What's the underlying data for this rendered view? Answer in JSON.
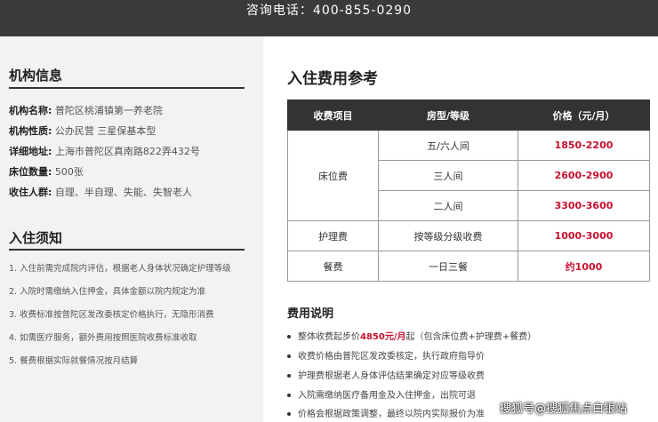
{
  "header": {
    "consult": "咨询电话：400-855-0290"
  },
  "sidebar": {
    "info_title": "机构信息",
    "info": [
      {
        "k": "机构名称:",
        "v": "普陀区桃浦镇第一养老院"
      },
      {
        "k": "机构性质:",
        "v": "公办民营 三星保基本型"
      },
      {
        "k": "详细地址:",
        "v": "上海市普陀区真南路822弄432号"
      },
      {
        "k": "床位数量:",
        "v": "500张"
      },
      {
        "k": "收住人群:",
        "v": "自理、半自理、失能、失智老人"
      }
    ],
    "notice_title": "入住须知",
    "notices": [
      "1. 入住前需完成院内评估，根据老人身体状况确定护理等级",
      "2. 入院时需缴纳入住押金，具体金额以院内规定为准",
      "3. 收费标准按普陀区发改委核定价格执行，无隐形消费",
      "4. 如需医疗服务，额外费用按照医院收费标准收取",
      "5. 餐费根据实际就餐情况按月结算"
    ]
  },
  "main": {
    "title": "入住费用参考",
    "table": {
      "headers": [
        "收费项目",
        "房型/等级",
        "价格（元/月）"
      ],
      "bed_label": "床位费",
      "bed_rows": [
        {
          "type": "五/六人间",
          "price": "1850-2200"
        },
        {
          "type": "三人间",
          "price": "2600-2900"
        },
        {
          "type": "二人间",
          "price": "3300-3600"
        }
      ],
      "care": {
        "item": "护理费",
        "type": "按等级分级收费",
        "price": "1000-3000"
      },
      "meal": {
        "item": "餐费",
        "type": "一日三餐",
        "price": "约1000"
      }
    },
    "notes_title": "费用说明",
    "notes": {
      "n1_pre": "整体收费起步价",
      "n1_hl": "4850元/月",
      "n1_post": "起（包含床位费+护理费+餐费）",
      "n2": "收费价格由普陀区发改委核定，执行政府指导价",
      "n3": "护理费根据老人身体评估结果确定对应等级收费",
      "n4": "入院需缴纳医疗备用金及入住押金，出院可退",
      "n5": "价格会根据政策调整，最终以院内实际报价为准"
    }
  },
  "watermark": "搜狐号@搜狐焦点白银站"
}
